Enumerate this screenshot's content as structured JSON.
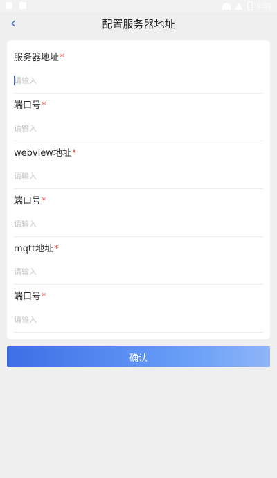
{
  "status": {
    "time": "9:39"
  },
  "header": {
    "title": "配置服务器地址",
    "back_glyph": "‹"
  },
  "form": {
    "fields": [
      {
        "label": "服务器地址",
        "required_mark": "*",
        "placeholder": "请输入",
        "value": ""
      },
      {
        "label": "端口号",
        "required_mark": "*",
        "placeholder": "请输入",
        "value": ""
      },
      {
        "label": "webview地址",
        "required_mark": "*",
        "placeholder": "请输入",
        "value": ""
      },
      {
        "label": "端口号",
        "required_mark": "*",
        "placeholder": "请输入",
        "value": ""
      },
      {
        "label": "mqtt地址",
        "required_mark": "*",
        "placeholder": "请输入",
        "value": ""
      },
      {
        "label": "端口号",
        "required_mark": "*",
        "placeholder": "请输入",
        "value": ""
      }
    ]
  },
  "actions": {
    "confirm_label": "确认"
  },
  "colors": {
    "accent": "#3b6ddf",
    "required": "#e24b3b",
    "background": "#efefef",
    "card": "#ffffff"
  }
}
